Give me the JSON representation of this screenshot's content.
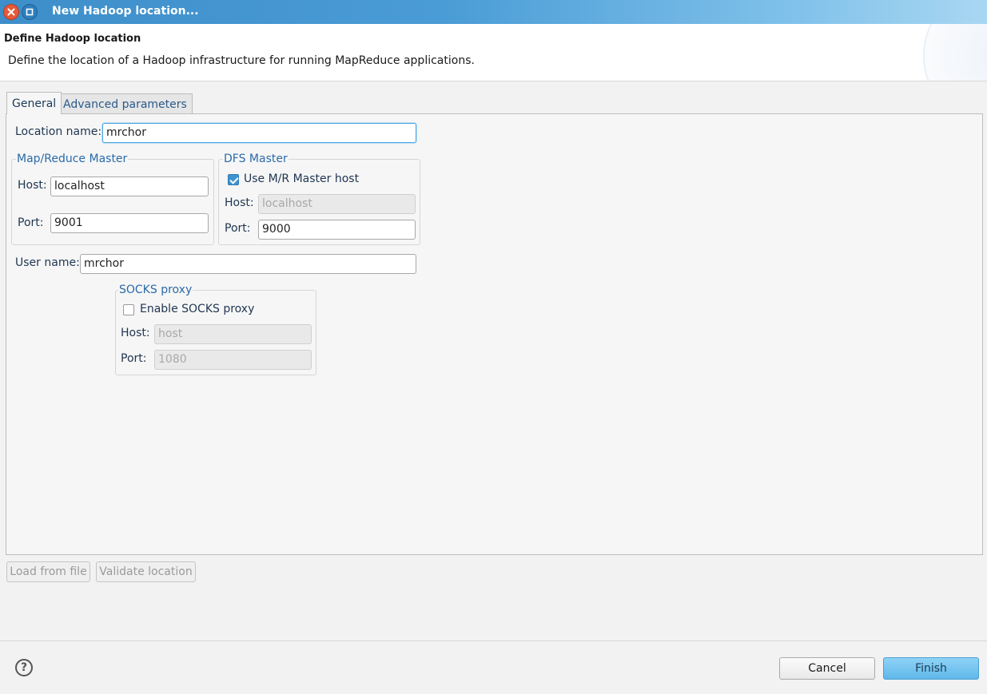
{
  "window": {
    "title": "New Hadoop location..."
  },
  "header": {
    "title": "Define Hadoop location",
    "description": "Define the location of a Hadoop infrastructure for running MapReduce applications."
  },
  "tabs": [
    {
      "label": "General",
      "active": true
    },
    {
      "label": "Advanced parameters",
      "active": false
    }
  ],
  "general": {
    "location_name_label": "Location name:",
    "location_name_value": "mrchor",
    "mapreduce_master": {
      "title": "Map/Reduce Master",
      "host_label": "Host:",
      "host_value": "localhost",
      "port_label": "Port:",
      "port_value": "9001"
    },
    "dfs_master": {
      "title": "DFS Master",
      "use_mr_host_label": "Use M/R Master host",
      "use_mr_host_checked": true,
      "host_label": "Host:",
      "host_value": "localhost",
      "port_label": "Port:",
      "port_value": "9000"
    },
    "user_name_label": "User name:",
    "user_name_value": "mrchor",
    "socks_proxy": {
      "title": "SOCKS proxy",
      "enable_label": "Enable SOCKS proxy",
      "enabled": false,
      "host_label": "Host:",
      "host_value": "host",
      "port_label": "Port:",
      "port_value": "1080"
    }
  },
  "actions": {
    "load_from_file": "Load from file",
    "validate_location": "Validate location"
  },
  "footer": {
    "help": "?",
    "cancel": "Cancel",
    "finish": "Finish"
  },
  "colors": {
    "titlebar": "#4a9cd6",
    "group_title": "#2a6aa8",
    "finish_button": "#6cc1ef",
    "focus_border": "#4aa3df"
  }
}
